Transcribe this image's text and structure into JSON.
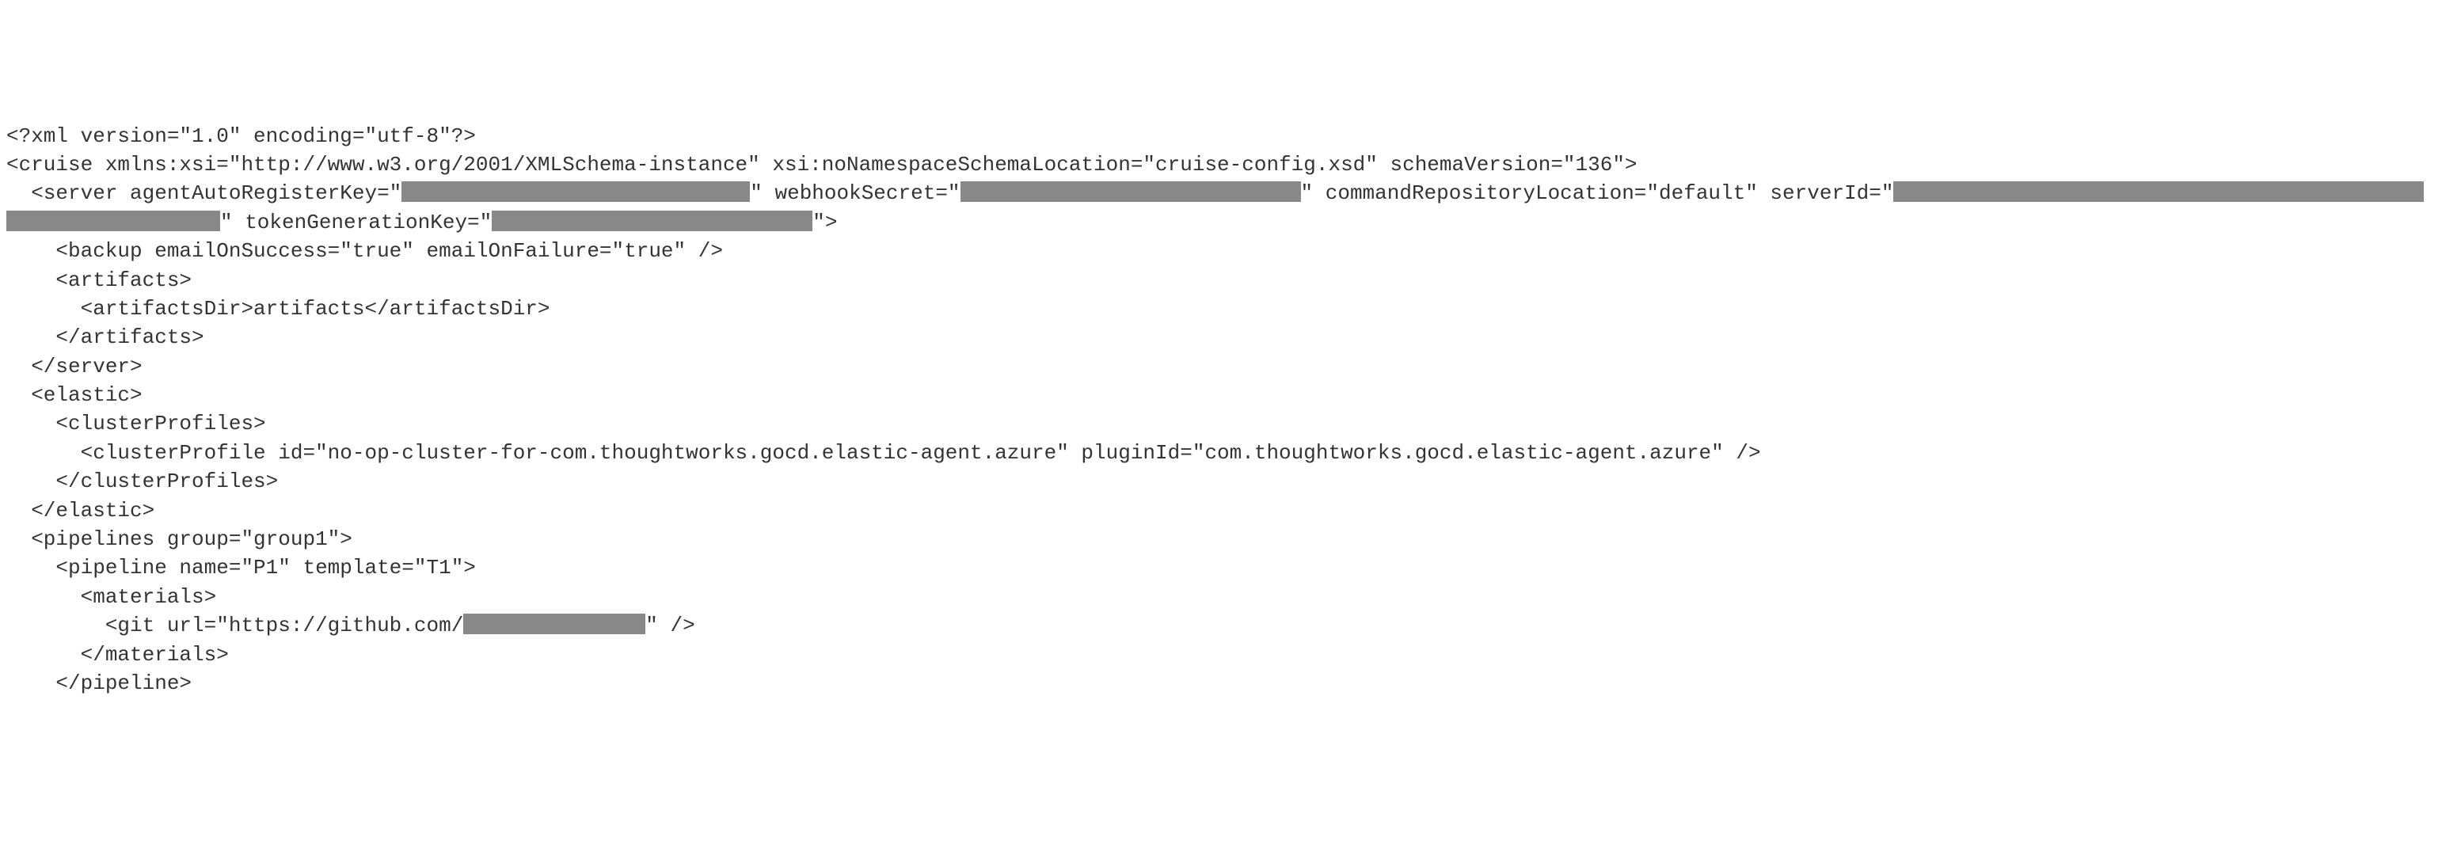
{
  "xml": {
    "declaration": "<?xml version=\"1.0\" encoding=\"utf-8\"?>",
    "cruise_open": "<cruise xmlns:xsi=\"http://www.w3.org/2001/XMLSchema-instance\" xsi:noNamespaceSchemaLocation=\"cruise-config.xsd\" schemaVersion=\"136\">",
    "server_open_part1": "  <server agentAutoRegisterKey=\"",
    "server_open_part2": "\" webhookSecret=\"",
    "server_open_part3": "\" commandRepositoryLocation=\"default\" serverId=\"",
    "server_open_part4": "\" tokenGenerationKey=\"",
    "server_open_part5": "\">",
    "backup": "    <backup emailOnSuccess=\"true\" emailOnFailure=\"true\" />",
    "artifacts_open": "    <artifacts>",
    "artifacts_dir": "      <artifactsDir>artifacts</artifactsDir>",
    "artifacts_close": "    </artifacts>",
    "server_close": "  </server>",
    "elastic_open": "  <elastic>",
    "cluster_profiles_open": "    <clusterProfiles>",
    "cluster_profile": "      <clusterProfile id=\"no-op-cluster-for-com.thoughtworks.gocd.elastic-agent.azure\" pluginId=\"com.thoughtworks.gocd.elastic-agent.azure\" />",
    "cluster_profiles_close": "    </clusterProfiles>",
    "elastic_close": "  </elastic>",
    "pipelines_open": "  <pipelines group=\"group1\">",
    "pipeline_open": "    <pipeline name=\"P1\" template=\"T1\">",
    "materials_open": "      <materials>",
    "git_part1": "        <git url=\"https://github.com/",
    "git_part2": "\" />",
    "materials_close": "      </materials>",
    "pipeline_close": "    </pipeline>"
  }
}
